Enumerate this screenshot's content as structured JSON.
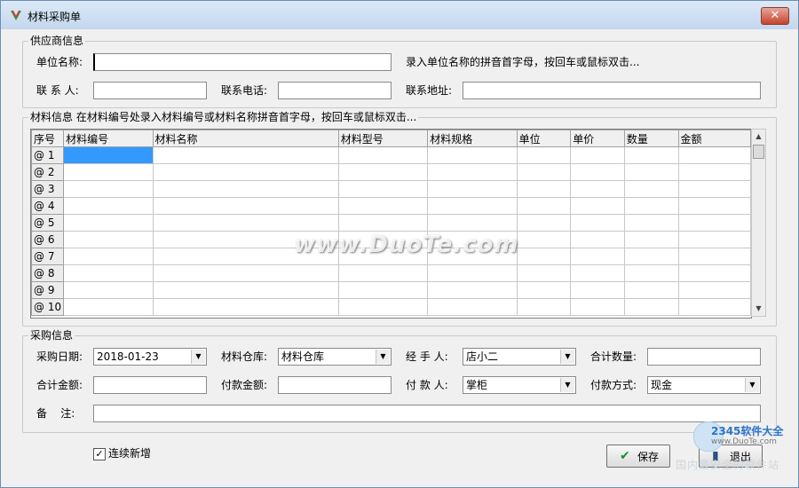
{
  "window": {
    "title": "材料采购单",
    "close_glyph": "✕"
  },
  "supplier": {
    "legend": "供应商信息",
    "unit_name_label": "单位名称:",
    "unit_name_value": "",
    "unit_hint": "录入单位名称的拼音首字母，按回车或鼠标双击...",
    "contact_label": "联 系 人:",
    "contact_value": "",
    "phone_label": "联系电话:",
    "phone_value": "",
    "address_label": "联系地址:",
    "address_value": ""
  },
  "materials": {
    "legend": "材料信息 在材料编号处录入材料编号或材料名称拼音首字母，按回车或鼠标双击...",
    "columns": [
      "序号",
      "材料编号",
      "材料名称",
      "材料型号",
      "材料规格",
      "单位",
      "单价",
      "数量",
      "金额"
    ],
    "rows": [
      "@ 1",
      "@ 2",
      "@ 3",
      "@ 4",
      "@ 5",
      "@ 6",
      "@ 7",
      "@ 8",
      "@ 9",
      "@ 10"
    ],
    "selected_row": 0,
    "scroll_up_glyph": "▲",
    "scroll_down_glyph": "▼"
  },
  "purchase": {
    "legend": "采购信息",
    "date_label": "采购日期:",
    "date_value": "2018-01-23",
    "warehouse_label": "材料仓库:",
    "warehouse_value": "材料仓库",
    "handler_label": "经 手 人:",
    "handler_value": "店小二",
    "total_qty_label": "合计数量:",
    "total_qty_value": "",
    "total_amount_label": "合计金额:",
    "total_amount_value": "",
    "paid_amount_label": "付款金额:",
    "paid_amount_value": "",
    "payer_label": "付 款 人:",
    "payer_value": "掌柜",
    "pay_method_label": "付款方式:",
    "pay_method_value": "现金",
    "remark_label": "备    注:",
    "remark_value": "",
    "dropdown_glyph": "▼"
  },
  "footer": {
    "continuous_add_label": "连续新增",
    "continuous_add_checked": true,
    "check_glyph": "✓",
    "save_label": "保存",
    "save_icon_glyph": "✔",
    "exit_label": "退出",
    "exit_icon_glyph": "▮"
  },
  "watermarks": {
    "center_text": "www.DuoTe.com",
    "corner_line1": "2345软件大全",
    "corner_line2": "www.DuoTe.com",
    "corner_line3": "国内最安全的软件站"
  },
  "colors": {
    "accent_selection": "#3399ff",
    "title_gradient_top": "#dce9f7",
    "close_red": "#c7432c",
    "save_icon": "#1f8f2a"
  }
}
